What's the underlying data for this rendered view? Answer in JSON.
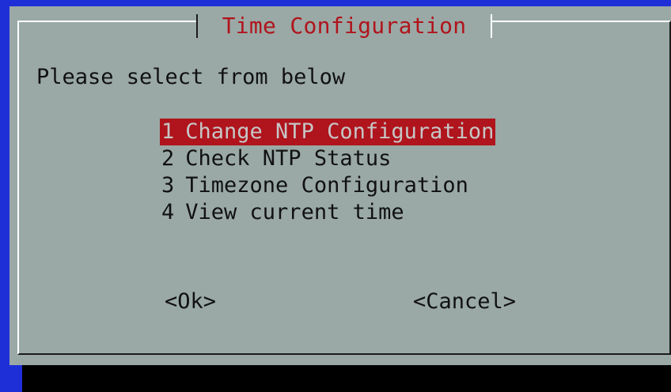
{
  "dialog": {
    "title": "Time Configuration",
    "prompt": "Please select from below",
    "menu_items": [
      {
        "key": "1",
        "label": "Change NTP Configuration",
        "selected": true
      },
      {
        "key": "2",
        "label": "Check NTP Status",
        "selected": false
      },
      {
        "key": "3",
        "label": "Timezone Configuration",
        "selected": false
      },
      {
        "key": "4",
        "label": "View current time",
        "selected": false
      }
    ],
    "buttons": {
      "ok": "<Ok>",
      "cancel": "<Cancel>"
    }
  },
  "colors": {
    "background": "#1f2fd8",
    "dialog": "#9aa9a6",
    "highlight": "#b0141c",
    "text": "#111111",
    "shadow": "#000000"
  }
}
